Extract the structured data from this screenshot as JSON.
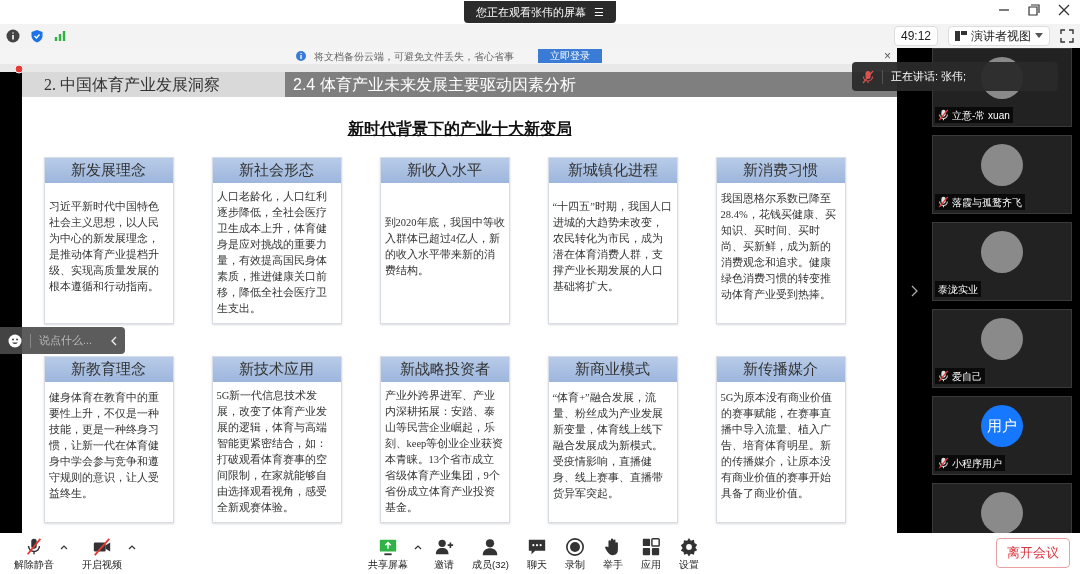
{
  "window": {
    "banner": "您正在观看张伟的屏幕",
    "banner_menu": "☰"
  },
  "toolbar": {
    "timer": "49:12",
    "view_button": "演讲者视图"
  },
  "notice": {
    "text": "将文档备份云端，可避免文件丢失，省心省事",
    "button": "立即登录",
    "close": "×"
  },
  "slide": {
    "section": "2.  中国体育产业发展洞察",
    "subsection": "2.4 体育产业未来发展主要驱动因素分析",
    "heading": "新时代背景下的产业十大新变局",
    "cards": [
      {
        "title": "新发展理念",
        "body": "习近平新时代中国特色社会主义思想，以人民为中心的新发展理念，是推动体育产业提档升级、实现高质量发展的根本遵循和行动指南。"
      },
      {
        "title": "新社会形态",
        "body": "人口老龄化，人口红利逐步降低，全社会医疗卫生成本上升，体育健身是应对挑战的重要力量，有效提高国民身体素质，推进健康关口前移，降低全社会医疗卫生支出。"
      },
      {
        "title": "新收入水平",
        "body": "到2020年底，我国中等收入群体已超过4亿人，新的收入水平带来新的消费结构。"
      },
      {
        "title": "新城镇化进程",
        "body": "“十四五”时期，我国人口进城的大趋势未改变，农民转化为市民，成为潜在体育消费人群，支撑产业长期发展的人口基础将扩大。"
      },
      {
        "title": "新消费习惯",
        "body": "我国恩格尔系数已降至28.4%，花钱买健康、买知识、买时间、买时尚、买新鲜，成为新的消费观念和追求。健康绿色消费习惯的转变推动体育产业受到热捧。"
      },
      {
        "title": "新教育理念",
        "body": "健身体育在教育中的重要性上升，不仅是一种技能，更是一种终身习惯，让新一代在体育健身中学会参与竞争和遵守规则的意识，让人受益终生。"
      },
      {
        "title": "新技术应用",
        "body": "5G新一代信息技术发展，改变了体育产业发展的逻辑，体育与高端智能更紧密结合，如：打破观看体育赛事的空间限制，在家就能够自由选择观看视角，感受全新观赛体验。"
      },
      {
        "title": "新战略投资者",
        "body": "产业外跨界进军、产业内深耕拓展：安踏、泰山等民营企业崛起，乐刻、keep等创业企业获资本青睐。13个省市成立省级体育产业集团，9个省份成立体育产业投资基金。"
      },
      {
        "title": "新商业模式",
        "body": "“体育+”融合发展，流量、粉丝成为产业发展新变量，体育线上线下融合发展成为新模式。受疫情影响，直播健身、线上赛事、直播带货异军突起。"
      },
      {
        "title": "新传播媒介",
        "body": "5G为原本没有商业价值的赛事赋能，在赛事直播中导入流量、植入广告、培育体育明星。新的传播媒介，让原本没有商业价值的赛事开始具备了商业价值。"
      }
    ]
  },
  "chat_input": {
    "placeholder": "说点什么..."
  },
  "speaking": "正在讲话: 张伟;",
  "participants": [
    {
      "name": "立意-常 xuan",
      "muted": true
    },
    {
      "name": "落霞与孤鹜齐飞",
      "muted": true
    },
    {
      "name": "泰泷实业",
      "muted": false
    },
    {
      "name": "爱自己",
      "muted": true
    },
    {
      "name": "小程序用户",
      "muted": true,
      "avatar_text": "用户"
    },
    {
      "muted": false
    }
  ],
  "controls": [
    {
      "kind": "mic-off",
      "label": "解除静音",
      "has_menu": true
    },
    {
      "kind": "camera-off",
      "label": "开启视频",
      "has_menu": true
    },
    {
      "kind": "share",
      "label": "共享屏幕",
      "has_menu": true
    },
    {
      "kind": "invite",
      "label": "邀请",
      "has_menu": false
    },
    {
      "kind": "members",
      "label": "成员(32)",
      "has_menu": false
    },
    {
      "kind": "chat",
      "label": "聊天",
      "has_menu": false
    },
    {
      "kind": "record",
      "label": "录制",
      "has_menu": false
    },
    {
      "kind": "hand",
      "label": "举手",
      "has_menu": false
    },
    {
      "kind": "apps",
      "label": "应用",
      "has_menu": false
    },
    {
      "kind": "settings",
      "label": "设置",
      "has_menu": false
    }
  ],
  "leave_button": "离开会议"
}
